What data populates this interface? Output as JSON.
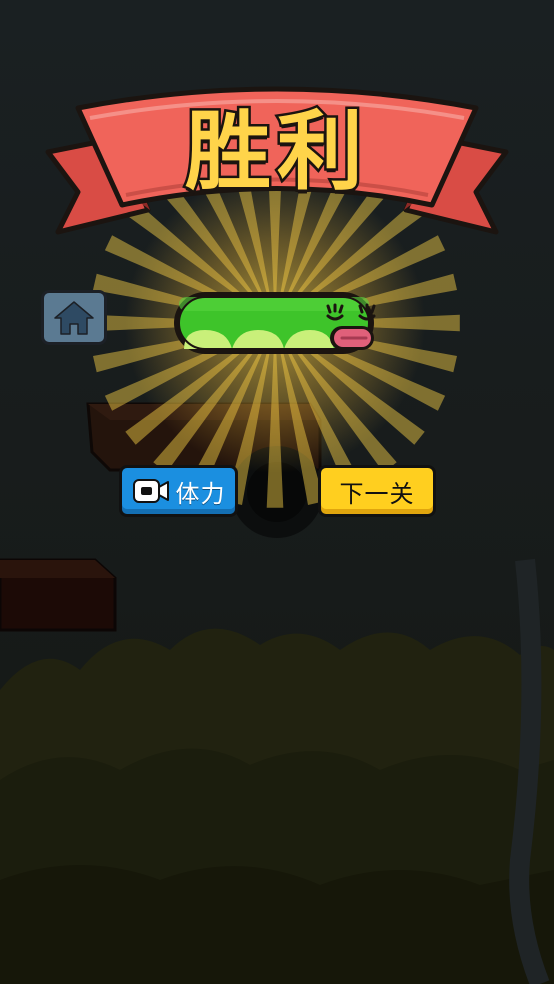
{
  "result": {
    "title": "胜利"
  },
  "buttons": {
    "home": {
      "icon": "home-icon"
    },
    "energy": {
      "icon": "video-camera-icon",
      "label": "体力"
    },
    "next": {
      "label": "下一关"
    }
  },
  "colors": {
    "banner": "#f0645a",
    "title_fill": "#ffd44a",
    "energy_button": "#1b8fe0",
    "next_button": "#ffcf1f",
    "home_button": "#5b7a92",
    "snake_body": "#3ec42a",
    "snake_belly": "#c9f07a",
    "snake_tongue": "#e0607a",
    "glow": "#ffd84a"
  }
}
